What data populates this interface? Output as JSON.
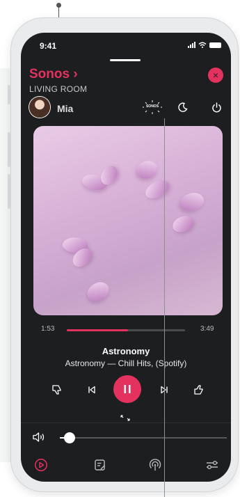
{
  "status_bar": {
    "time": "9:41"
  },
  "header": {
    "brand": "Sonos",
    "brand_chevron": "›",
    "room": "LIVING ROOM",
    "close_icon": "×",
    "user_name": "Mia",
    "sonos_badge_text": "SONOS"
  },
  "player": {
    "elapsed": "1:53",
    "duration": "3:49",
    "progress": 0.52,
    "track_title": "Astronomy",
    "track_subtitle": "Astronomy — Chill Hits, (Spotify)"
  },
  "volume": {
    "level": 0.08
  },
  "icons": {
    "brand_chevron": "chevron-right-icon",
    "close": "close-icon",
    "sonos": "sonos-logo-icon",
    "sleep": "moon-icon",
    "power": "power-icon",
    "dislike": "thumbs-down-icon",
    "previous": "skip-previous-icon",
    "pause": "pause-icon",
    "next": "skip-next-icon",
    "like": "thumbs-up-icon",
    "volume": "speaker-volume-icon",
    "nav_play": "play-circle-icon",
    "nav_queue": "queue-icon",
    "nav_radio": "broadcast-icon",
    "nav_settings": "settings-sliders-icon"
  },
  "colors": {
    "accent": "#e4325f",
    "screen_bg": "#1d1e20",
    "text": "#ffffff"
  }
}
